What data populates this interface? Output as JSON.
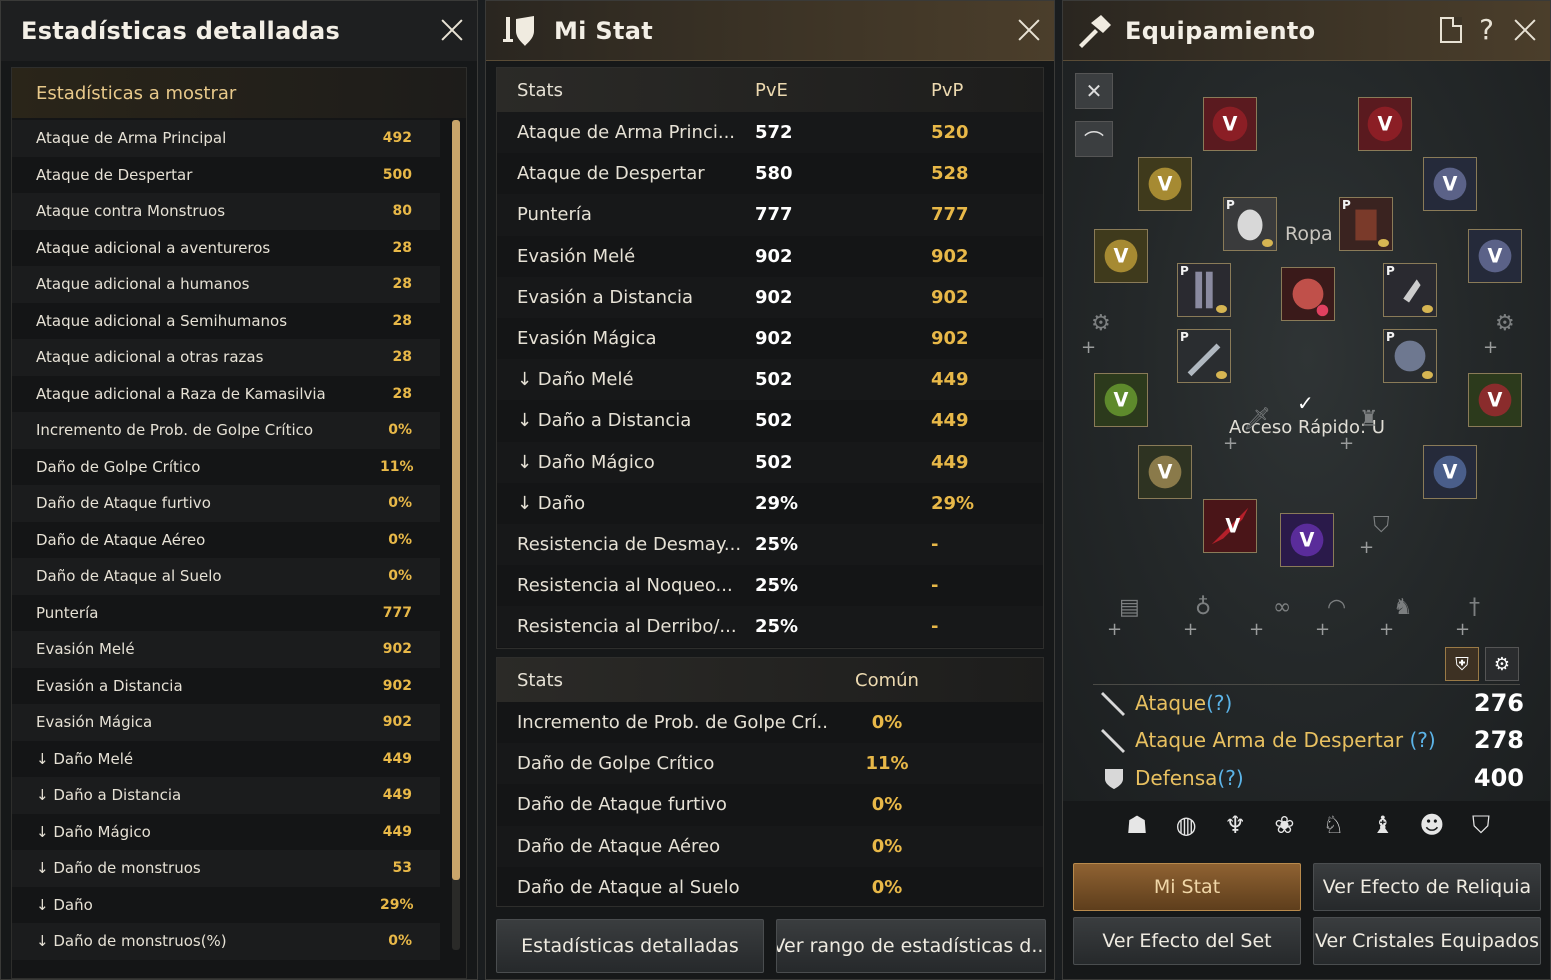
{
  "detailed": {
    "title": "Estadísticas detalladas",
    "heading": "Estadísticas a mostrar",
    "rows": [
      {
        "label": "Ataque de Arma Principal",
        "value": "492"
      },
      {
        "label": "Ataque de Despertar",
        "value": "500"
      },
      {
        "label": "Ataque contra Monstruos",
        "value": "80"
      },
      {
        "label": "Ataque adicional a aventureros",
        "value": "28"
      },
      {
        "label": "Ataque adicional a humanos",
        "value": "28"
      },
      {
        "label": "Ataque adicional a Semihumanos",
        "value": "28"
      },
      {
        "label": "Ataque adicional a otras razas",
        "value": "28"
      },
      {
        "label": "Ataque adicional a Raza de Kamasilvia",
        "value": "28"
      },
      {
        "label": "Incremento de Prob. de Golpe Crítico",
        "value": "0%"
      },
      {
        "label": "Daño de Golpe Crítico",
        "value": "11%"
      },
      {
        "label": "Daño de Ataque furtivo",
        "value": "0%"
      },
      {
        "label": "Daño de Ataque Aéreo",
        "value": "0%"
      },
      {
        "label": "Daño de Ataque al Suelo",
        "value": "0%"
      },
      {
        "label": "Puntería",
        "value": "777"
      },
      {
        "label": "Evasión Melé",
        "value": "902"
      },
      {
        "label": "Evasión a Distancia",
        "value": "902"
      },
      {
        "label": "Evasión Mágica",
        "value": "902"
      },
      {
        "label": "↓ Daño Melé",
        "value": "449"
      },
      {
        "label": "↓ Daño a Distancia",
        "value": "449"
      },
      {
        "label": "↓ Daño Mágico",
        "value": "449"
      },
      {
        "label": "↓ Daño de monstruos",
        "value": "53"
      },
      {
        "label": "↓ Daño",
        "value": "29%"
      },
      {
        "label": "↓ Daño de monstruos(%)",
        "value": "0%"
      }
    ]
  },
  "mystat": {
    "title": "Mi Stat",
    "table1": {
      "headers": [
        "Stats",
        "PvE",
        "PvP"
      ],
      "rows": [
        [
          "Ataque de Arma Princi...",
          "572",
          "520"
        ],
        [
          "Ataque de Despertar",
          "580",
          "528"
        ],
        [
          "Puntería",
          "777",
          "777"
        ],
        [
          "Evasión Melé",
          "902",
          "902"
        ],
        [
          "Evasión a Distancia",
          "902",
          "902"
        ],
        [
          "Evasión Mágica",
          "902",
          "902"
        ],
        [
          "↓ Daño Melé",
          "502",
          "449"
        ],
        [
          "↓ Daño a Distancia",
          "502",
          "449"
        ],
        [
          "↓ Daño Mágico",
          "502",
          "449"
        ],
        [
          "↓ Daño",
          "29%",
          "29%"
        ],
        [
          "Resistencia de Desmay...",
          "25%",
          "-"
        ],
        [
          "Resistencia al Noqueo...",
          "25%",
          "-"
        ],
        [
          "Resistencia al Derribo/...",
          "25%",
          "-"
        ]
      ]
    },
    "table2": {
      "headers": [
        "Stats",
        "Común"
      ],
      "rows": [
        [
          "Incremento de Prob. de Golpe Crí...",
          "0%"
        ],
        [
          "Daño de Golpe Crítico",
          "11%"
        ],
        [
          "Daño de Ataque furtivo",
          "0%"
        ],
        [
          "Daño de Ataque Aéreo",
          "0%"
        ],
        [
          "Daño de Ataque al Suelo",
          "0%"
        ]
      ]
    },
    "btn_detailed": "Estadísticas detalladas",
    "btn_range": "Ver rango de estadísticas d..."
  },
  "equip": {
    "title": "Equipamiento",
    "help": "?",
    "clothes_label": "Ropa",
    "quick_access": "Acceso Rápido: U",
    "attack_label": "Ataque",
    "awakening_label": "Ataque Arma de Despertar ",
    "defense_label": "Defensa",
    "q": "(?)",
    "attack_value": "276",
    "awakening_value": "278",
    "defense_value": "400",
    "btn_mystat": "Mi Stat",
    "btn_relic": "Ver Efecto de Reliquia",
    "btn_set": "Ver Efecto del Set",
    "btn_crystals": "Ver Cristales Equipados",
    "v_letter": "V",
    "p_letter": "P"
  }
}
